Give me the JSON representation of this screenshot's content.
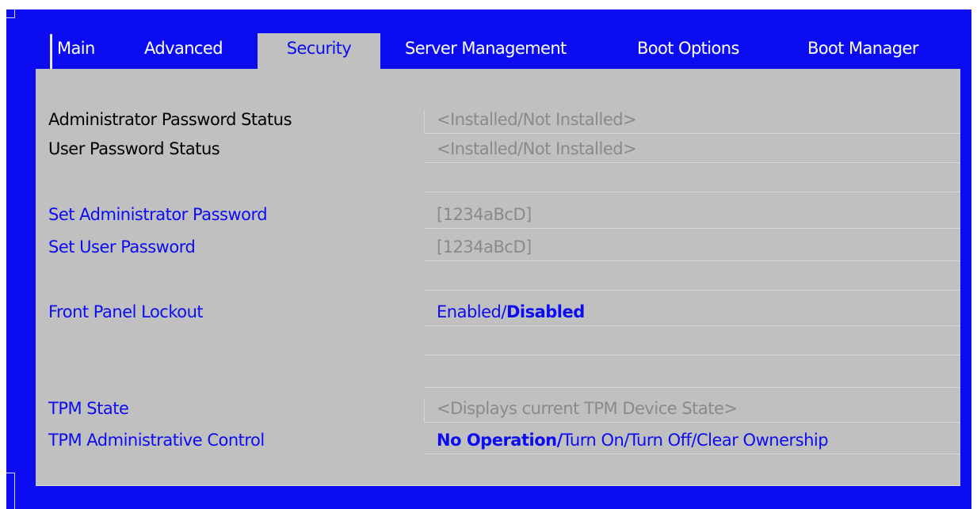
{
  "tabs": [
    {
      "label": "Main"
    },
    {
      "label": "Advanced"
    },
    {
      "label": "Security"
    },
    {
      "label": "Server Management"
    },
    {
      "label": "Boot Options"
    },
    {
      "label": "Boot Manager"
    }
  ],
  "active_tab": "Security",
  "settings": {
    "admin_password_status": {
      "label": "Administrator Password Status",
      "value": "<Installed/Not Installed>"
    },
    "user_password_status": {
      "label": "User Password Status",
      "value": "<Installed/Not Installed>"
    },
    "set_admin_password": {
      "label": "Set Administrator Password",
      "value": "[1234aBcD]"
    },
    "set_user_password": {
      "label": "Set User Password",
      "value": "[1234aBcD]"
    },
    "front_panel_lockout": {
      "label": "Front Panel Lockout",
      "option_1": "Enabled/",
      "option_selected": "Disabled"
    },
    "tpm_state": {
      "label": "TPM State",
      "value": "<Displays current TPM Device State>"
    },
    "tpm_admin_control": {
      "label": "TPM Administrative Control",
      "option_selected": "No Operation/",
      "options_rest": "Turn On/Turn Off/Clear Ownership"
    }
  },
  "colors": {
    "frame_blue": "#0c0cf2",
    "panel_gray": "#c0c0c0",
    "value_gray": "#8a8a8a"
  }
}
